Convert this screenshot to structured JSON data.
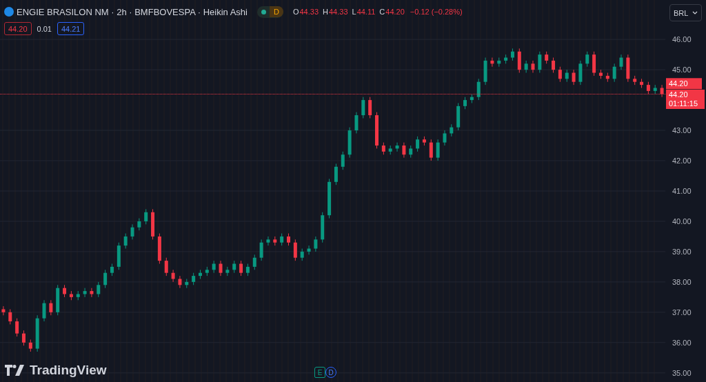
{
  "header": {
    "title": "ENGIE BRASILON NM · 2h · BMFBOVESPA · Heikin Ashi",
    "badge": "D",
    "ohlc": [
      {
        "label": "O",
        "value": "44.33"
      },
      {
        "label": "H",
        "value": "44.33"
      },
      {
        "label": "L",
        "value": "44.11"
      },
      {
        "label": "C",
        "value": "44.20"
      }
    ],
    "change": "−0.12 (−0.28%)"
  },
  "trade": {
    "sell": "44.20",
    "spread": "0.01",
    "buy": "44.21"
  },
  "currency": "BRL",
  "price_axis": {
    "last_price": "44.20",
    "countdown_price": "44.20",
    "countdown": "01:11:15"
  },
  "chart_data": {
    "type": "candlestick",
    "grid": true,
    "ylim": [
      34.7,
      47.3
    ],
    "ohlc": [
      [
        37.1,
        37.2,
        36.9,
        37.0
      ],
      [
        37.0,
        37.1,
        36.6,
        36.7
      ],
      [
        36.7,
        36.8,
        36.2,
        36.3
      ],
      [
        36.3,
        36.4,
        35.9,
        36.0
      ],
      [
        36.0,
        36.1,
        35.7,
        35.8
      ],
      [
        35.8,
        36.9,
        35.7,
        36.8
      ],
      [
        36.8,
        37.4,
        36.7,
        37.3
      ],
      [
        37.3,
        37.4,
        36.9,
        37.0
      ],
      [
        37.0,
        37.9,
        36.9,
        37.8
      ],
      [
        37.8,
        37.9,
        37.5,
        37.6
      ],
      [
        37.6,
        37.7,
        37.4,
        37.5
      ],
      [
        37.5,
        37.7,
        37.4,
        37.6
      ],
      [
        37.6,
        37.8,
        37.5,
        37.7
      ],
      [
        37.7,
        37.8,
        37.5,
        37.6
      ],
      [
        37.6,
        38.0,
        37.5,
        37.9
      ],
      [
        37.9,
        38.4,
        37.8,
        38.3
      ],
      [
        38.3,
        38.6,
        38.2,
        38.5
      ],
      [
        38.5,
        39.3,
        38.4,
        39.2
      ],
      [
        39.2,
        39.6,
        39.1,
        39.5
      ],
      [
        39.5,
        39.9,
        39.4,
        39.8
      ],
      [
        39.8,
        40.1,
        39.7,
        40.0
      ],
      [
        40.0,
        40.4,
        39.9,
        40.3
      ],
      [
        40.3,
        40.4,
        39.4,
        39.5
      ],
      [
        39.5,
        39.6,
        38.6,
        38.7
      ],
      [
        38.7,
        38.8,
        38.2,
        38.3
      ],
      [
        38.3,
        38.4,
        38.0,
        38.1
      ],
      [
        38.1,
        38.2,
        37.8,
        37.9
      ],
      [
        37.9,
        38.1,
        37.8,
        38.0
      ],
      [
        38.0,
        38.3,
        37.9,
        38.2
      ],
      [
        38.2,
        38.4,
        38.1,
        38.3
      ],
      [
        38.3,
        38.5,
        38.2,
        38.4
      ],
      [
        38.4,
        38.7,
        38.3,
        38.6
      ],
      [
        38.6,
        38.7,
        38.2,
        38.3
      ],
      [
        38.3,
        38.5,
        38.2,
        38.4
      ],
      [
        38.4,
        38.7,
        38.3,
        38.6
      ],
      [
        38.6,
        38.7,
        38.2,
        38.3
      ],
      [
        38.3,
        38.6,
        38.2,
        38.5
      ],
      [
        38.5,
        38.9,
        38.4,
        38.8
      ],
      [
        38.8,
        39.4,
        38.7,
        39.3
      ],
      [
        39.3,
        39.5,
        39.2,
        39.4
      ],
      [
        39.4,
        39.5,
        39.2,
        39.3
      ],
      [
        39.3,
        39.6,
        39.2,
        39.5
      ],
      [
        39.5,
        39.6,
        39.2,
        39.3
      ],
      [
        39.3,
        39.4,
        38.7,
        38.8
      ],
      [
        38.8,
        39.1,
        38.7,
        39.0
      ],
      [
        39.0,
        39.2,
        38.9,
        39.1
      ],
      [
        39.1,
        39.5,
        39.0,
        39.4
      ],
      [
        39.4,
        40.3,
        39.3,
        40.2
      ],
      [
        40.2,
        41.4,
        40.1,
        41.3
      ],
      [
        41.3,
        41.9,
        41.2,
        41.8
      ],
      [
        41.8,
        42.3,
        41.7,
        42.2
      ],
      [
        42.2,
        43.1,
        42.1,
        43.0
      ],
      [
        43.0,
        43.6,
        42.9,
        43.5
      ],
      [
        43.5,
        44.1,
        43.4,
        44.0
      ],
      [
        44.0,
        44.1,
        43.4,
        43.5
      ],
      [
        43.5,
        43.6,
        42.4,
        42.5
      ],
      [
        42.5,
        42.6,
        42.2,
        42.3
      ],
      [
        42.3,
        42.5,
        42.2,
        42.4
      ],
      [
        42.4,
        42.6,
        42.3,
        42.5
      ],
      [
        42.5,
        42.6,
        42.1,
        42.2
      ],
      [
        42.2,
        42.5,
        42.1,
        42.4
      ],
      [
        42.4,
        42.8,
        42.3,
        42.7
      ],
      [
        42.7,
        42.8,
        42.5,
        42.6
      ],
      [
        42.6,
        42.7,
        42.0,
        42.1
      ],
      [
        42.1,
        42.7,
        42.0,
        42.6
      ],
      [
        42.6,
        43.0,
        42.5,
        42.9
      ],
      [
        42.9,
        43.2,
        42.8,
        43.1
      ],
      [
        43.1,
        43.9,
        43.0,
        43.8
      ],
      [
        43.8,
        44.1,
        43.7,
        44.0
      ],
      [
        44.0,
        44.2,
        43.9,
        44.1
      ],
      [
        44.1,
        44.7,
        44.0,
        44.6
      ],
      [
        44.6,
        45.4,
        44.5,
        45.3
      ],
      [
        45.3,
        45.4,
        45.1,
        45.2
      ],
      [
        45.2,
        45.4,
        45.1,
        45.3
      ],
      [
        45.3,
        45.5,
        45.2,
        45.4
      ],
      [
        45.4,
        45.7,
        45.3,
        45.6
      ],
      [
        45.6,
        45.7,
        44.9,
        45.0
      ],
      [
        45.0,
        45.3,
        44.9,
        45.2
      ],
      [
        45.2,
        45.3,
        44.9,
        45.0
      ],
      [
        45.0,
        45.6,
        44.9,
        45.5
      ],
      [
        45.5,
        45.6,
        45.2,
        45.3
      ],
      [
        45.3,
        45.4,
        44.9,
        45.0
      ],
      [
        45.0,
        45.1,
        44.6,
        44.7
      ],
      [
        44.7,
        45.0,
        44.6,
        44.9
      ],
      [
        44.9,
        45.0,
        44.5,
        44.6
      ],
      [
        44.6,
        45.3,
        44.5,
        45.2
      ],
      [
        45.2,
        45.6,
        45.1,
        45.5
      ],
      [
        45.5,
        45.6,
        44.8,
        44.9
      ],
      [
        44.9,
        45.0,
        44.7,
        44.8
      ],
      [
        44.8,
        44.9,
        44.6,
        44.7
      ],
      [
        44.7,
        45.2,
        44.6,
        45.1
      ],
      [
        45.1,
        45.5,
        45.0,
        45.4
      ],
      [
        45.4,
        45.5,
        44.6,
        44.7
      ],
      [
        44.7,
        44.8,
        44.5,
        44.6
      ],
      [
        44.6,
        44.7,
        44.4,
        44.5
      ],
      [
        44.5,
        44.6,
        44.2,
        44.3
      ],
      [
        44.3,
        44.5,
        44.2,
        44.4
      ],
      [
        44.4,
        44.5,
        44.1,
        44.2
      ]
    ],
    "yticks": [
      {
        "value": 46,
        "label": "46.00"
      },
      {
        "value": 45,
        "label": "45.00"
      },
      {
        "value": 43,
        "label": "43.00"
      },
      {
        "value": 42,
        "label": "42.00"
      },
      {
        "value": 41,
        "label": "41.00"
      },
      {
        "value": 40,
        "label": "40.00"
      },
      {
        "value": 39,
        "label": "39.00"
      },
      {
        "value": 38,
        "label": "38.00"
      },
      {
        "value": 37,
        "label": "37.00"
      },
      {
        "value": 36,
        "label": "36.00"
      },
      {
        "value": 35,
        "label": "35.00"
      }
    ]
  },
  "logo": "TradingView",
  "events": [
    {
      "kind": "earnings",
      "label": "E"
    },
    {
      "kind": "dividend",
      "label": "D"
    }
  ]
}
